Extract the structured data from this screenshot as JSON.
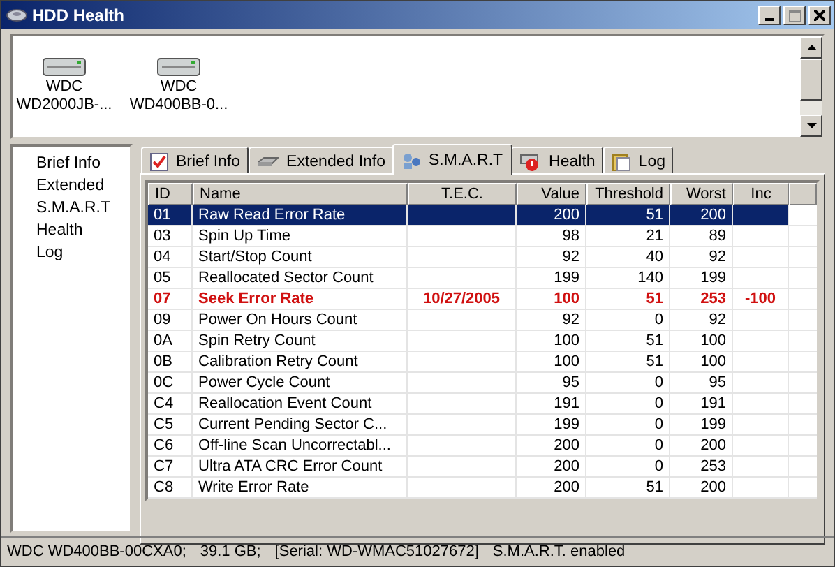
{
  "window": {
    "title": "HDD Health"
  },
  "drives": [
    {
      "line1": "WDC",
      "line2": "WD2000JB-..."
    },
    {
      "line1": "WDC",
      "line2": "WD400BB-0..."
    }
  ],
  "sidebar": {
    "items": [
      {
        "label": "Brief Info"
      },
      {
        "label": "Extended"
      },
      {
        "label": "S.M.A.R.T"
      },
      {
        "label": "Health"
      },
      {
        "label": "Log"
      }
    ]
  },
  "tabs": [
    {
      "label": "Brief Info",
      "selected": false
    },
    {
      "label": "Extended Info",
      "selected": false
    },
    {
      "label": "S.M.A.R.T",
      "selected": true
    },
    {
      "label": "Health",
      "selected": false
    },
    {
      "label": "Log",
      "selected": false
    }
  ],
  "table": {
    "columns": [
      "ID",
      "Name",
      "T.E.C.",
      "Value",
      "Threshold",
      "Worst",
      "Inc"
    ],
    "rows": [
      {
        "cells": [
          "01",
          "Raw Read Error Rate",
          "",
          "200",
          "51",
          "200",
          ""
        ],
        "selected": true,
        "alert": false
      },
      {
        "cells": [
          "03",
          "Spin Up Time",
          "",
          "98",
          "21",
          "89",
          ""
        ],
        "selected": false,
        "alert": false
      },
      {
        "cells": [
          "04",
          "Start/Stop Count",
          "",
          "92",
          "40",
          "92",
          ""
        ],
        "selected": false,
        "alert": false
      },
      {
        "cells": [
          "05",
          "Reallocated Sector Count",
          "",
          "199",
          "140",
          "199",
          ""
        ],
        "selected": false,
        "alert": false
      },
      {
        "cells": [
          "07",
          "Seek Error Rate",
          "10/27/2005",
          "100",
          "51",
          "253",
          "-100"
        ],
        "selected": false,
        "alert": true
      },
      {
        "cells": [
          "09",
          "Power On Hours Count",
          "",
          "92",
          "0",
          "92",
          ""
        ],
        "selected": false,
        "alert": false
      },
      {
        "cells": [
          "0A",
          "Spin Retry Count",
          "",
          "100",
          "51",
          "100",
          ""
        ],
        "selected": false,
        "alert": false
      },
      {
        "cells": [
          "0B",
          "Calibration Retry Count",
          "",
          "100",
          "51",
          "100",
          ""
        ],
        "selected": false,
        "alert": false
      },
      {
        "cells": [
          "0C",
          "Power Cycle Count",
          "",
          "95",
          "0",
          "95",
          ""
        ],
        "selected": false,
        "alert": false
      },
      {
        "cells": [
          "C4",
          "Reallocation Event Count",
          "",
          "191",
          "0",
          "191",
          ""
        ],
        "selected": false,
        "alert": false
      },
      {
        "cells": [
          "C5",
          "Current Pending Sector C...",
          "",
          "199",
          "0",
          "199",
          ""
        ],
        "selected": false,
        "alert": false
      },
      {
        "cells": [
          "C6",
          "Off-line Scan Uncorrectabl...",
          "",
          "200",
          "0",
          "200",
          ""
        ],
        "selected": false,
        "alert": false
      },
      {
        "cells": [
          "C7",
          "Ultra ATA CRC Error Count",
          "",
          "200",
          "0",
          "253",
          ""
        ],
        "selected": false,
        "alert": false
      },
      {
        "cells": [
          "C8",
          "Write Error Rate",
          "",
          "200",
          "51",
          "200",
          ""
        ],
        "selected": false,
        "alert": false
      }
    ]
  },
  "status_bar": [
    "WDC WD400BB-00CXA0;",
    "39.1 GB;",
    "[Serial: WD-WMAC51027672]",
    "S.M.A.R.T. enabled"
  ]
}
